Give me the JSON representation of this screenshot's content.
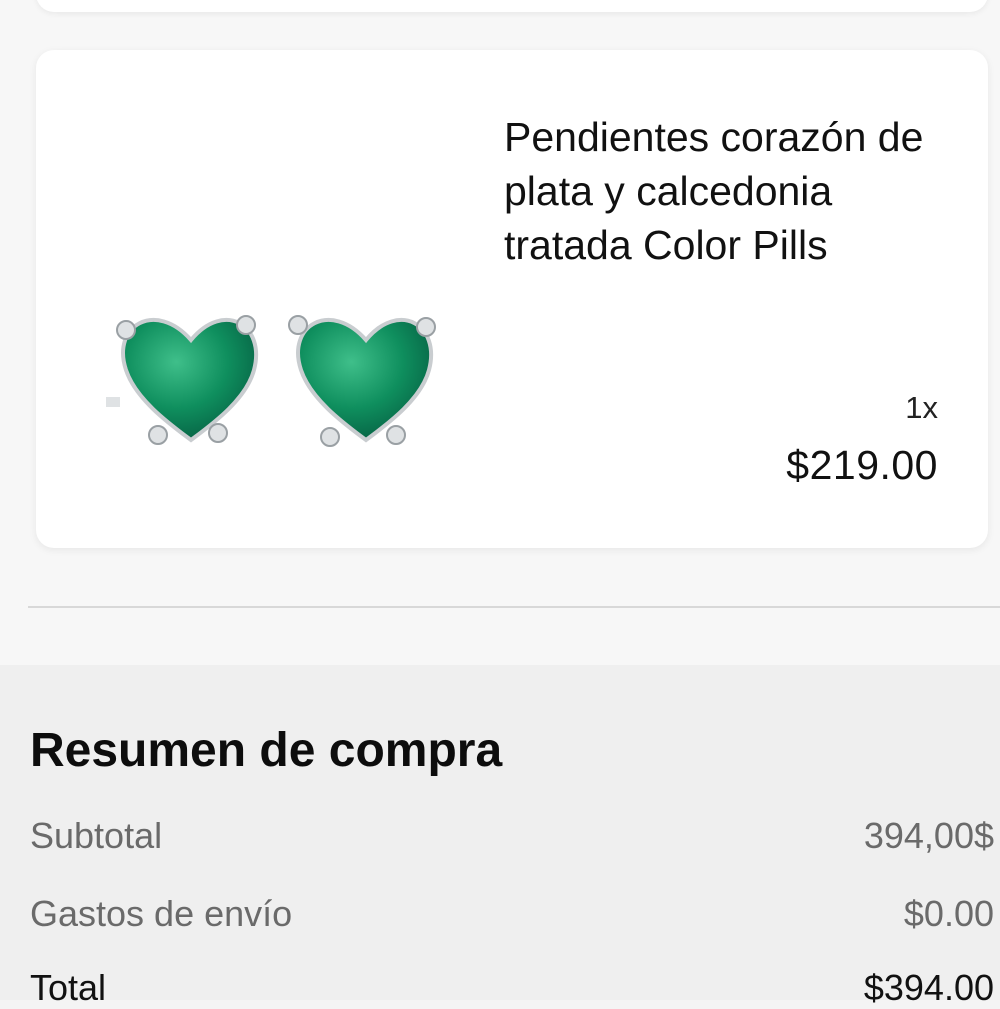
{
  "product": {
    "title": "Pendientes corazón de plata y calcedonia tratada Color Pills",
    "quantity": "1x",
    "price": "$219.00",
    "image_icon": "heart-earrings-image",
    "gem_color": "#0f8f5e",
    "metal_color": "#c9cdd0"
  },
  "summary": {
    "title": "Resumen de compra",
    "rows": [
      {
        "label": "Subtotal",
        "value": "394,00$"
      },
      {
        "label": "Gastos de envío",
        "value": "$0.00"
      },
      {
        "label": "Total",
        "value": "$394.00"
      }
    ]
  }
}
